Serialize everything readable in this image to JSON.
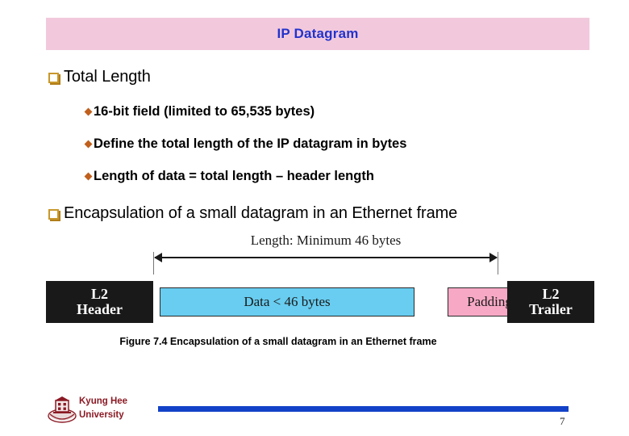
{
  "slide": {
    "title": "IP Datagram",
    "title_bg_color": "#f2c9dc",
    "title_text_color": "#2233cc",
    "page_number": "7"
  },
  "bullets": [
    {
      "level": 1,
      "marker": "square-bullet",
      "text": "Total Length",
      "children": [
        {
          "level": 2,
          "marker": "diamond-bullet",
          "text": "16-bit field (limited to 65,535 bytes)"
        },
        {
          "level": 2,
          "marker": "diamond-bullet",
          "text": "Define the total length of the IP datagram in bytes"
        },
        {
          "level": 2,
          "marker": "diamond-bullet",
          "text": "Length of data = total length – header length"
        }
      ]
    },
    {
      "level": 1,
      "marker": "square-bullet",
      "text": "Encapsulation of a small datagram in an Ethernet frame",
      "children": []
    }
  ],
  "figure": {
    "measure_label": "Length: Minimum 46 bytes",
    "blocks": [
      {
        "name": "l2-header",
        "line1": "L2",
        "line2": "Header",
        "fill": "#191919",
        "text_color": "#ffffff"
      },
      {
        "name": "data",
        "label": "Data <  46 bytes",
        "fill": "#68cdf0",
        "text_color": "#1a1a1a"
      },
      {
        "name": "padding",
        "label": "Padding",
        "fill": "#f7a8c4",
        "text_color": "#1a1a1a"
      },
      {
        "name": "l2-trailer",
        "line1": "L2",
        "line2": "Trailer",
        "fill": "#191919",
        "text_color": "#ffffff"
      }
    ],
    "caption": "Figure 7.4 Encapsulation of a small datagram in an Ethernet frame"
  },
  "footer": {
    "university_line1": "Kyung Hee",
    "university_line2": "University",
    "brand_color": "#8b1a24",
    "bar_color": "#1342c8"
  }
}
